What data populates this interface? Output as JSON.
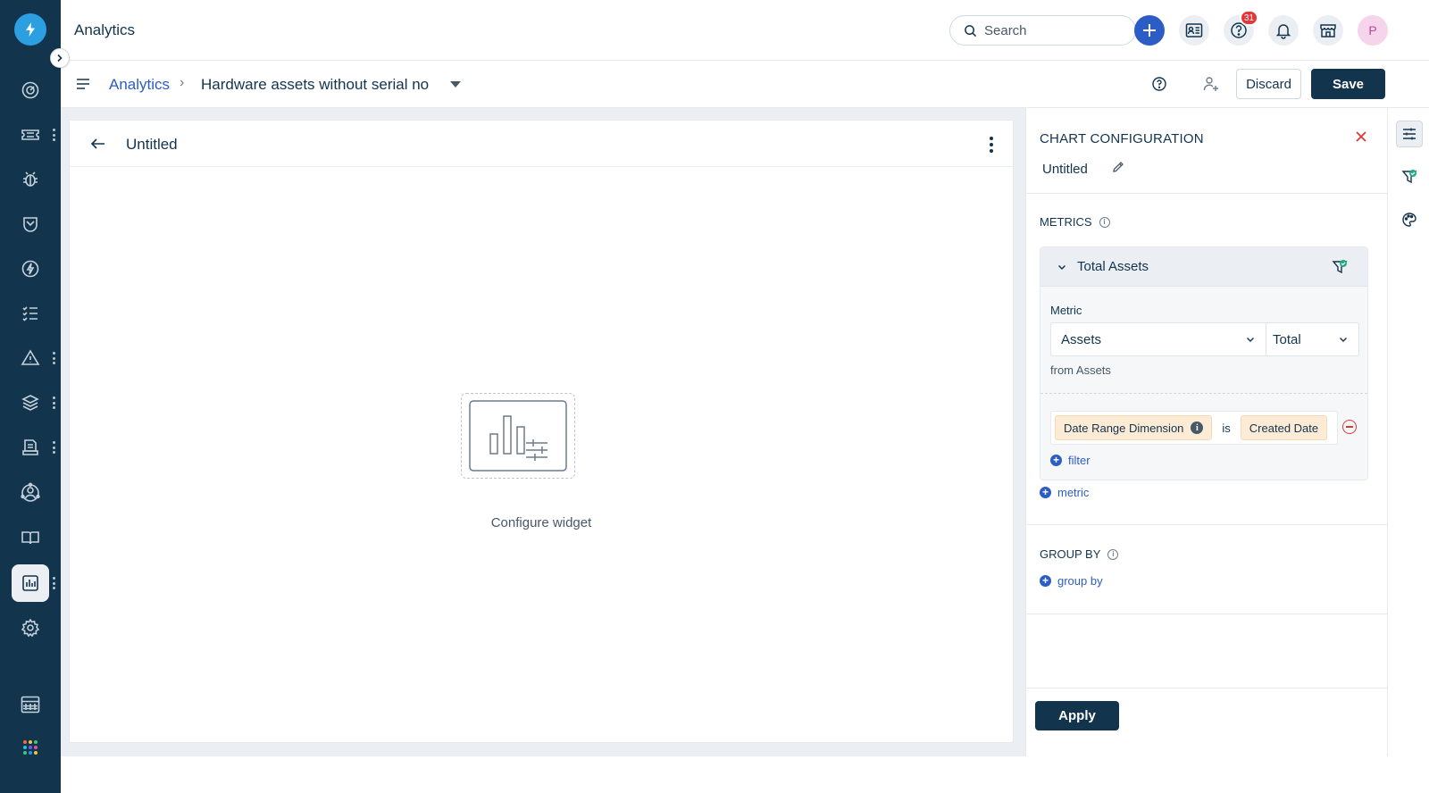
{
  "header": {
    "app_title": "Analytics",
    "search_placeholder": "Search",
    "help_badge": "31",
    "avatar_initial": "P"
  },
  "breadcrumb": {
    "root": "Analytics",
    "separator": "›",
    "current": "Hardware assets without serial no"
  },
  "actions": {
    "discard": "Discard",
    "save": "Save"
  },
  "widget": {
    "title": "Untitled",
    "empty_text": "Configure widget"
  },
  "config": {
    "heading": "CHART CONFIGURATION",
    "name": "Untitled",
    "metrics_label": "METRICS",
    "metric": {
      "name": "Total Assets",
      "field_label": "Metric",
      "source_value": "Assets",
      "aggregation_value": "Total",
      "from_text": "from Assets",
      "filter": {
        "dimension": "Date Range Dimension",
        "operator": "is",
        "value": "Created Date"
      },
      "add_filter": "filter"
    },
    "add_metric": "metric",
    "group_by_label": "GROUP BY",
    "add_group_by": "group by",
    "apply": "Apply"
  },
  "colors": {
    "rail": "#12344d",
    "accent": "#2c5cc5",
    "danger": "#e43538",
    "chip": "#fdebd6"
  },
  "icons": {
    "rail": [
      "dashboard-icon",
      "tickets-icon",
      "problems-icon",
      "changes-icon",
      "releases-icon",
      "tasks-icon",
      "alerts-icon",
      "assets-icon",
      "contracts-icon",
      "projects-icon",
      "solutions-icon",
      "analytics-icon",
      "admin-icon",
      "calendar-icon",
      "apps-grid-icon"
    ]
  }
}
